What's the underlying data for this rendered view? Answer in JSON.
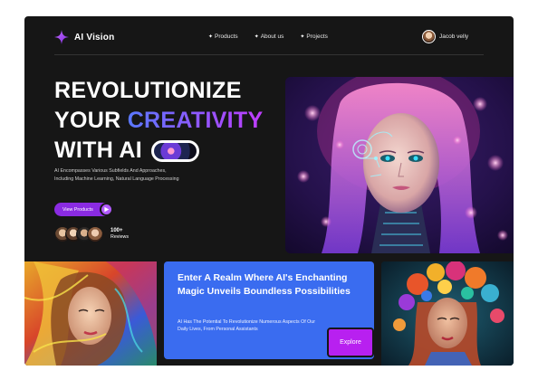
{
  "brand": {
    "name": "AI Vision",
    "icon": "sparkle-icon",
    "accent": "#a23cff"
  },
  "nav": {
    "links": [
      {
        "label": "Products",
        "icon": "star-icon"
      },
      {
        "label": "About us",
        "icon": "star-icon"
      },
      {
        "label": "Projects",
        "icon": "star-icon"
      }
    ]
  },
  "user": {
    "name": "Jacob velly",
    "icon": "avatar"
  },
  "hero": {
    "line1": "REVOLUTIONIZE",
    "line2a": "YOUR ",
    "line2b": "CREATIVITY",
    "line3": "WITH AI",
    "description": "AI Encompasses Various Subfields And Approaches, Including Machine Learning, Natural Language Processing",
    "cta_label": "View Products",
    "cta_icon": "play-icon",
    "reviews_count": "100+",
    "reviews_label": "Reviews",
    "gradient": [
      "#5a78ff",
      "#c03cff"
    ]
  },
  "feature": {
    "title": "Enter A Realm Where AI's Enchanting Magic Unveils Boundless Possibilities",
    "text": "AI Has The Potential To Revolutionize Numerous Aspects Of Our Daily Lives, From Personal Assistants",
    "button_label": "Explore",
    "card_color": "#3a6cf0",
    "button_color": "#b820f0"
  }
}
